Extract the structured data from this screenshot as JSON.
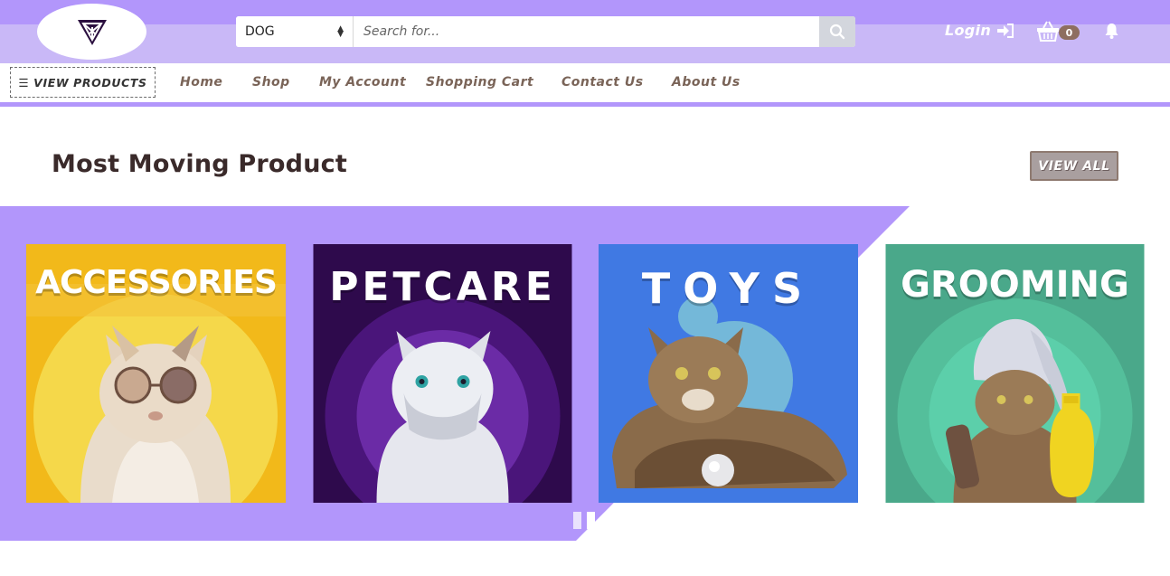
{
  "header": {
    "search": {
      "category_selected": "DOG",
      "placeholder": "Search for..."
    },
    "login_label": "Login",
    "cart_count": "0"
  },
  "nav": {
    "view_products_label": "VIEW PRODUCTS",
    "links": [
      "Home",
      "Shop",
      "My Account",
      "Shopping Cart",
      "Contact Us",
      "About Us"
    ]
  },
  "section": {
    "title": "Most Moving Product",
    "view_all_label": "VIEW ALL"
  },
  "products": [
    {
      "title": "ACCESSORIES",
      "bg": "#f2b91a",
      "accent": "#f5d84a"
    },
    {
      "title": "PETCARE",
      "bg": "#3b1063",
      "accent": "#6b2ba6"
    },
    {
      "title": "TOYS",
      "bg": "#4079e3",
      "accent": "#74b8d9"
    },
    {
      "title": "GROOMING",
      "bg": "#4aa88a",
      "accent": "#5ccfaa"
    }
  ],
  "carousel": {
    "slide_count": 2,
    "active_index": 1
  },
  "colors": {
    "topbar": "#c9b8f7",
    "topbar_strip": "#b296fb",
    "band": "#b296fb",
    "nav_text": "#7a6458",
    "view_all_bg": "#a99f9f"
  },
  "icons": [
    "logo-icon",
    "search-icon",
    "login-icon",
    "cart-icon",
    "bell-icon",
    "menu-icon"
  ]
}
